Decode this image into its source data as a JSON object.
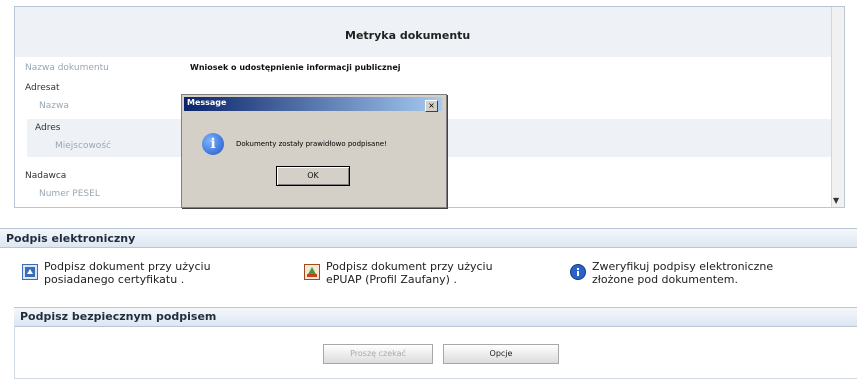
{
  "metryka": {
    "title": "Metryka dokumentu",
    "nazwa_label": "Nazwa dokumentu",
    "nazwa_value": "Wniosek o udostępnienie informacji publicznej",
    "adresat": "Adresat",
    "adresat_nazwa": "Nazwa",
    "adres": "Adres",
    "miejscowosc": "Miejscowość",
    "nadawca": "Nadawca",
    "pesel": "Numer PESEL"
  },
  "dialog": {
    "title": "Message",
    "close": "×",
    "message": "Dokumenty zostały prawidłowo podpisane!",
    "ok": "OK"
  },
  "podpis": {
    "header": "Podpis elektroniczny",
    "opt1_line1": "Podpisz dokument przy użyciu",
    "opt1_line2": "posiadanego certyfikatu .",
    "opt2_line1": "Podpisz dokument przy użyciu",
    "opt2_line2": "ePUAP (Profil Zaufany) .",
    "opt3_line1": "Zweryfikuj podpisy elektroniczne",
    "opt3_line2": "złożone pod dokumentem."
  },
  "bezpieczny": {
    "header": "Podpisz bezpiecznym podpisem",
    "btn1": "Proszę czekać",
    "btn2": "Opcje"
  }
}
